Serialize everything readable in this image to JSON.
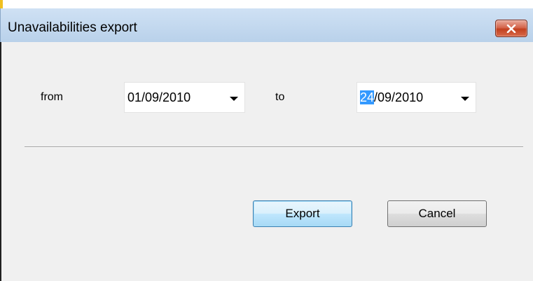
{
  "dialog": {
    "title": "Unavailabilities export",
    "close_icon": "close-icon"
  },
  "range": {
    "from_label": "from",
    "from_value": "01/09/2010",
    "to_label": "to",
    "to_value_selected": "24",
    "to_value_rest": "/09/2010"
  },
  "buttons": {
    "export_label": "Export",
    "cancel_label": "Cancel"
  },
  "colors": {
    "titlebar": "#b9d1ea",
    "close_button": "#c2401f",
    "selection": "#3399ff",
    "client_background": "#f0f0f0"
  }
}
